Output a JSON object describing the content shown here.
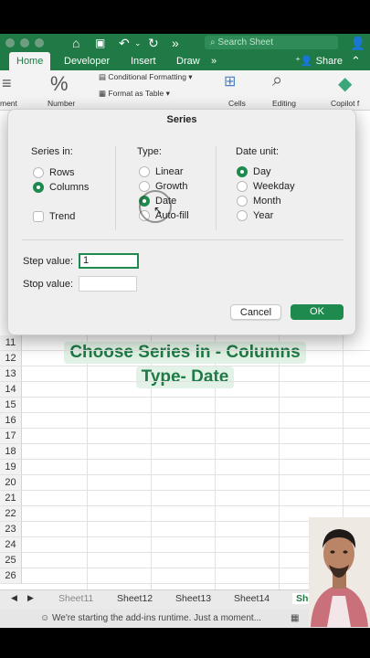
{
  "titlebar": {
    "search_placeholder": "Search Sheet"
  },
  "tabs": {
    "items": [
      "Home",
      "Developer",
      "Insert",
      "Draw"
    ],
    "active": "Home",
    "more": "»",
    "share_label": "Share"
  },
  "ribbon": {
    "alignment_label": "ment",
    "number_label": "Number",
    "conditional_formatting": "Conditional Formatting",
    "format_as_table": "Format as Table",
    "cells_label": "Cells",
    "editing_label": "Editing",
    "copilot_label": "Copilot f"
  },
  "rows": [
    "11",
    "12",
    "13",
    "14",
    "15",
    "16",
    "17",
    "18",
    "19",
    "20",
    "21",
    "22",
    "23",
    "24",
    "25",
    "26"
  ],
  "sheet_tabs": [
    "Sheet11",
    "Sheet12",
    "Sheet13",
    "Sheet14",
    "She"
  ],
  "status_text": "We're starting the add-ins runtime. Just a moment...",
  "dialog": {
    "title": "Series",
    "series_in": {
      "title": "Series in:",
      "options": [
        "Rows",
        "Columns"
      ],
      "selected": "Columns"
    },
    "type": {
      "title": "Type:",
      "options": [
        "Linear",
        "Growth",
        "Date",
        "Auto-fill"
      ],
      "selected": "Date"
    },
    "date_unit": {
      "title": "Date unit:",
      "options": [
        "Day",
        "Weekday",
        "Month",
        "Year"
      ],
      "selected": "Day"
    },
    "trend_label": "Trend",
    "step_label": "Step value:",
    "step_value": "1",
    "stop_label": "Stop value:",
    "stop_value": "",
    "cancel_label": "Cancel",
    "ok_label": "OK"
  },
  "caption": {
    "line1": "Choose Series in - Columns",
    "line2": "Type- Date"
  },
  "colors": {
    "excel_green": "#1f7a45",
    "accent": "#1f8a4d",
    "caption_bg": "#e3f2e6"
  }
}
